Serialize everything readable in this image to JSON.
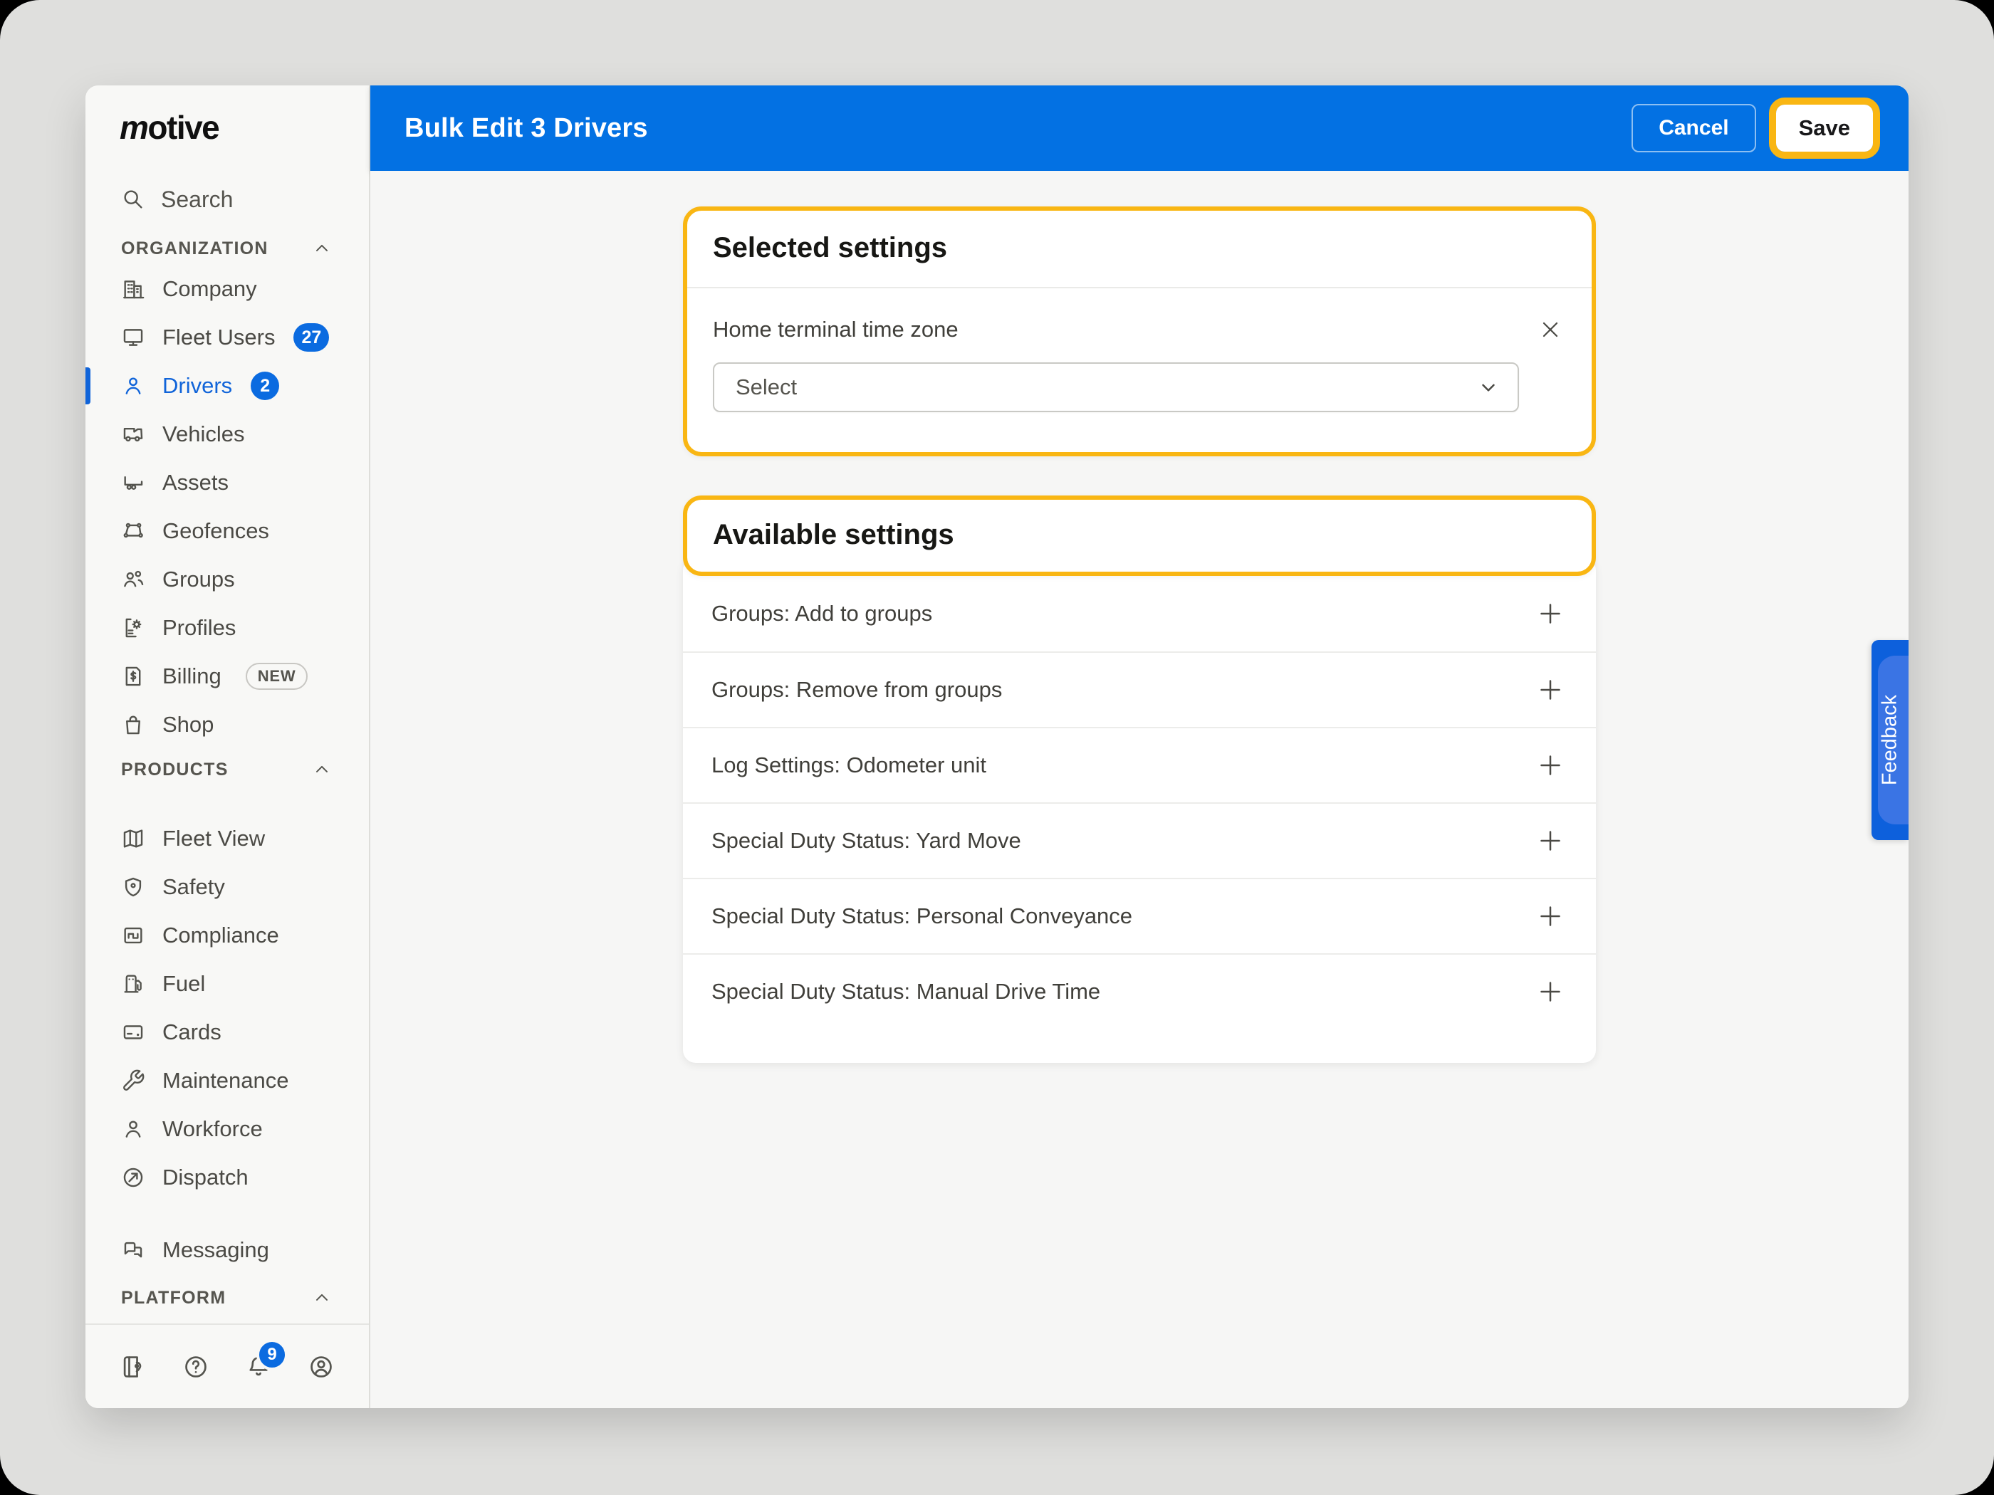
{
  "header": {
    "title": "Bulk Edit 3 Drivers",
    "cancel_label": "Cancel",
    "save_label": "Save"
  },
  "sidebar": {
    "logo_text": "motive",
    "search_label": "Search",
    "sections": {
      "organization": "ORGANIZATION",
      "products": "PRODUCTS",
      "platform": "PLATFORM"
    },
    "org_items": [
      {
        "label": "Company"
      },
      {
        "label": "Fleet Users",
        "badge": "27"
      },
      {
        "label": "Drivers",
        "badge": "2",
        "active": true
      },
      {
        "label": "Vehicles"
      },
      {
        "label": "Assets"
      },
      {
        "label": "Geofences"
      },
      {
        "label": "Groups"
      },
      {
        "label": "Profiles"
      },
      {
        "label": "Billing",
        "tag": "NEW"
      },
      {
        "label": "Shop"
      }
    ],
    "product_items": [
      {
        "label": "Fleet View"
      },
      {
        "label": "Safety"
      },
      {
        "label": "Compliance"
      },
      {
        "label": "Fuel"
      },
      {
        "label": "Cards"
      },
      {
        "label": "Maintenance"
      },
      {
        "label": "Workforce"
      },
      {
        "label": "Dispatch"
      },
      {
        "label": "Messaging"
      }
    ],
    "footer": {
      "notifications_count": "9"
    }
  },
  "main": {
    "selected_settings": {
      "title": "Selected settings",
      "field_label": "Home terminal time zone",
      "select_value": "Select"
    },
    "available_settings": {
      "title": "Available settings",
      "rows": [
        "Groups: Add to groups",
        "Groups: Remove from groups",
        "Log Settings: Odometer unit",
        "Special Duty Status: Yard Move",
        "Special Duty Status: Personal Conveyance",
        "Special Duty Status: Manual Drive Time"
      ]
    }
  },
  "feedback_tab": {
    "label": "Feedback"
  },
  "colors": {
    "header_blue": "#0371E3",
    "active_blue": "#1064D9",
    "badge_blue": "#0B6BE0",
    "highlight_yellow": "#F9B613"
  }
}
